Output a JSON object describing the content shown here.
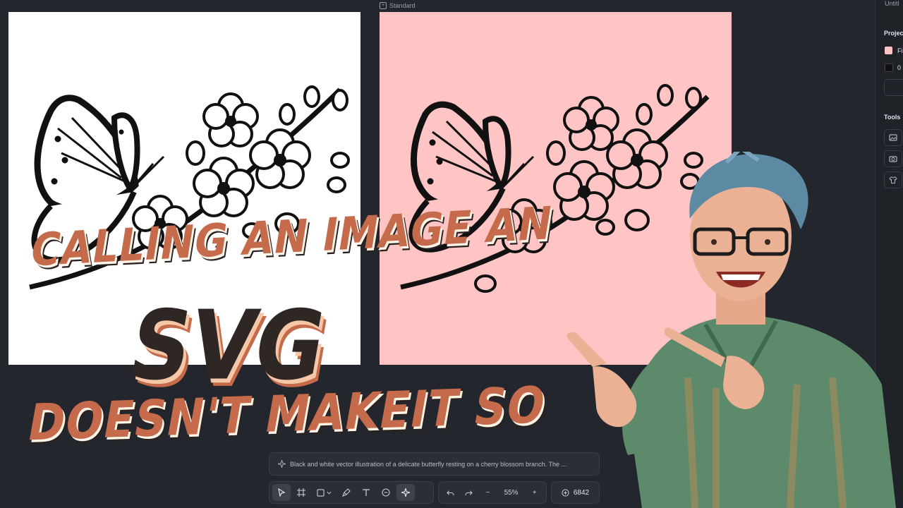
{
  "canvas": {
    "top_label": "Standard",
    "original_bg": "#ffffff",
    "pink_bg": "#ffc4c4"
  },
  "right_panel": {
    "title": "Untitl",
    "project_heading": "Projec",
    "fill_label": "Fi",
    "fill_color": "#ffc4c4",
    "stroke_label": "0",
    "stroke_color": "#111111",
    "tools_heading": "Tools",
    "tool_icons": [
      "image-tool-icon",
      "camera-tool-icon",
      "shirt-tool-icon"
    ]
  },
  "prompt": {
    "text": "Black and white vector illustration of a delicate butterfly resting on a cherry blossom branch. The ..."
  },
  "toolbar": {
    "tools": [
      "pointer-icon",
      "frame-icon",
      "rectangle-icon",
      "pen-icon",
      "text-icon",
      "comment-icon",
      "ai-sparkle-icon"
    ],
    "active_tool": "pointer-icon",
    "zoom_value": "55%",
    "zoom_minus": "−",
    "zoom_plus": "+",
    "credits": "6842"
  },
  "overlay": {
    "line1": "CALLING AN IMAGE AN",
    "line2": "SVG",
    "line3": "DOESN'T MAKEIT SO",
    "accent_color": "#c56a4b",
    "dark_color": "#2f2724"
  }
}
